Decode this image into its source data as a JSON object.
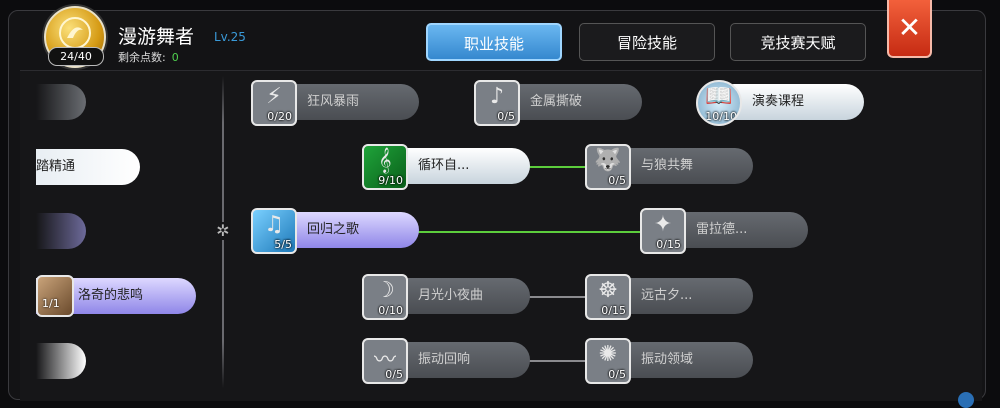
{
  "header": {
    "avatar_count": "24/40",
    "name": "漫游舞者",
    "level": "Lv.25",
    "points_label": "剩余点数:",
    "points_value": "0"
  },
  "tabs": [
    {
      "label": "职业技能",
      "active": true
    },
    {
      "label": "冒险技能",
      "active": false
    },
    {
      "label": "竞技赛天赋",
      "active": false
    }
  ],
  "close_label": "✕",
  "left_column": [
    {
      "label": "",
      "count": ""
    },
    {
      "label": "踏精通",
      "count": ""
    },
    {
      "label": "",
      "count": ""
    },
    {
      "label": "洛奇的悲鸣",
      "count": "1/1"
    },
    {
      "label": "",
      "count": ""
    }
  ],
  "skills": [
    {
      "label": "狂风暴雨",
      "count": "0/20",
      "icon": "storm-icon"
    },
    {
      "label": "金属撕破",
      "count": "0/5",
      "icon": "metal-icon"
    },
    {
      "label": "演奏课程",
      "count": "10/10",
      "icon": "book-icon"
    },
    {
      "label": "循环自...",
      "count": "9/10",
      "icon": "music-note-icon"
    },
    {
      "label": "与狼共舞",
      "count": "0/5",
      "icon": "wolf-icon"
    },
    {
      "label": "回归之歌",
      "count": "5/5",
      "icon": "song-return-icon"
    },
    {
      "label": "雷拉德...",
      "count": "0/15",
      "icon": "sparkle-drop-icon"
    },
    {
      "label": "月光小夜曲",
      "count": "0/10",
      "icon": "moonlight-icon"
    },
    {
      "label": "远古夕...",
      "count": "0/15",
      "icon": "ancient-icon"
    },
    {
      "label": "振动回响",
      "count": "0/5",
      "icon": "vibration-icon"
    },
    {
      "label": "振动领域",
      "count": "0/5",
      "icon": "vibration-field-icon"
    }
  ],
  "colors": {
    "accent": "#3588cf",
    "close": "#d8391f",
    "active_link": "#5ccd3c"
  }
}
